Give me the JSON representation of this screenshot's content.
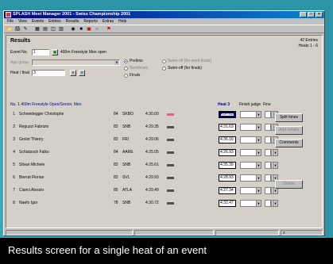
{
  "window": {
    "title": "SPLASH Meet Manager 2001 - Swiss Championship 2001",
    "controls": [
      "_",
      "□",
      "×"
    ]
  },
  "menu": [
    "File",
    "View",
    "Events",
    "Entries",
    "Results",
    "Reports",
    "Extras",
    "Help"
  ],
  "toolbar_icons": [
    "open-icon",
    "print-icon",
    "tool-icon",
    "grid-icon",
    "table-icon",
    "preview-icon",
    "chart-icon",
    "view-icon",
    "stop-icon",
    "red-icon",
    "settings-icon",
    "flag-icon"
  ],
  "results": {
    "heading": "Results",
    "entries_count": "42 Entries",
    "heats_info": "Heats 1 - 6",
    "event_no_label": "Event No.",
    "event_no_value": "1",
    "event_name": "400m Freestyle Men open",
    "age_group_label": "Age group",
    "mode_options": {
      "prelims": "Prelims",
      "semifinals": "Semifinals",
      "finals": "Finals",
      "swimoff_semi": "Swim-off (for semi-finals)",
      "swimoff_finals": "Swim-off (for finals)"
    },
    "heat_final_label": "Heat / final",
    "heat_final_value": "3",
    "event_line": "No. 1  400m Freestyle Open/Senior, Men",
    "heat_label": "Heat 3",
    "col_finish_judge": "Finish judge",
    "col_fine": "Fine"
  },
  "rows": [
    {
      "pos": "1",
      "name": "Schneidegger Christophe",
      "yob": "84",
      "club": "SKBO",
      "entry": "4:30.00",
      "time": "4:37.03",
      "bar": "red",
      "selected": true
    },
    {
      "pos": "2",
      "name": "Reguzzi Fabrizio",
      "yob": "82",
      "club": "SNB",
      "entry": "4:29.35",
      "time": "4:31.63",
      "bar": "gray",
      "selected": false
    },
    {
      "pos": "3",
      "name": "Grolet Thierry",
      "yob": "82",
      "club": "FRI",
      "entry": "4:29.06",
      "time": "4:36.16",
      "bar": "gray",
      "selected": false
    },
    {
      "pos": "4",
      "name": "Schlatzsch Falko",
      "yob": "84",
      "club": "AARE",
      "entry": "4:25.05",
      "time": "4:26.93",
      "bar": "gray",
      "selected": false
    },
    {
      "pos": "5",
      "name": "Silvan Michele",
      "yob": "82",
      "club": "SNB",
      "entry": "4:25.61",
      "time": "4:35.39",
      "bar": "gray",
      "selected": false
    },
    {
      "pos": "6",
      "name": "Bierrat Florian",
      "yob": "82",
      "club": "SVL",
      "entry": "4:29.93",
      "time": "4:28.93",
      "bar": "gray",
      "selected": false
    },
    {
      "pos": "7",
      "name": "Cianci Alessio",
      "yob": "85",
      "club": "ATLA",
      "entry": "4:29.49",
      "time": "4:27.34",
      "bar": "gray",
      "selected": false
    },
    {
      "pos": "8",
      "name": "Naefo Igor",
      "yob": "78",
      "club": "SNB",
      "entry": "4:30.72",
      "time": "4:32.47",
      "bar": "gray",
      "selected": false
    }
  ],
  "side_buttons": {
    "split_times": "Split times",
    "add_details": "Add details",
    "comments": "Comments",
    "delete": "Delete"
  },
  "status": {
    "right": "3"
  },
  "caption": "Results screen for a single heat of an event",
  "colors": {
    "title_start": "#000080",
    "title_end": "#1084d0",
    "bar_red": "#ff4f8a",
    "background": "#39a8b8"
  }
}
